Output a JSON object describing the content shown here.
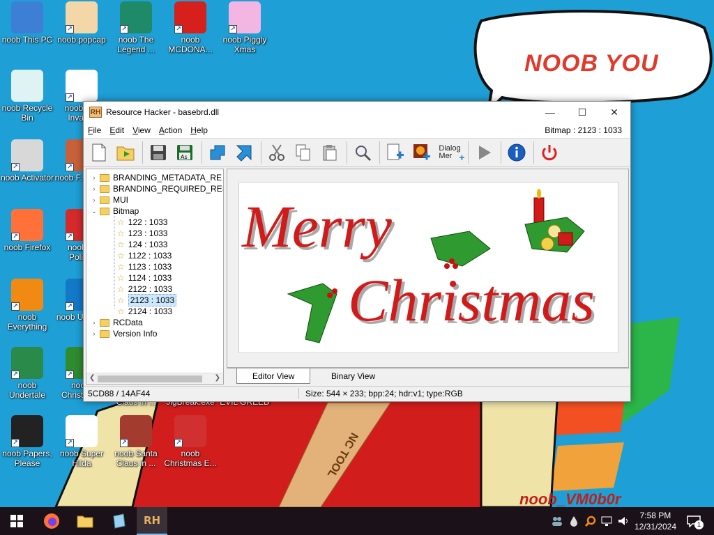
{
  "desktop": {
    "icons": [
      {
        "label": "noob This PC",
        "icon": "this-pc-icon",
        "color": "#3e7fd6"
      },
      {
        "label": "noob popcap",
        "icon": "popcap-icon",
        "color": "#f3d7a8"
      },
      {
        "label": "noob The Legend ...",
        "icon": "game-character-icon",
        "color": "#1f8a67"
      },
      {
        "label": "noob MCDONA...",
        "icon": "mcdonalds-icon",
        "color": "#d6201b"
      },
      {
        "label": "noob Piggly Xmas",
        "icon": "pig-icon",
        "color": "#f3b6e3"
      },
      {
        "label": "noob Recycle Bin",
        "icon": "recycle-bin-icon",
        "color": "#dff3f5"
      },
      {
        "label": "noob C... Invad...",
        "icon": "chicken-icon",
        "color": "#ffffff"
      },
      {
        "label": "noob Activator",
        "icon": "activator-icon",
        "color": "#d8d8d8"
      },
      {
        "label": "noob F... Pla...",
        "icon": "game-icon",
        "color": "#c8603a"
      },
      {
        "label": "noob Firefox",
        "icon": "firefox-icon",
        "color": "#ff7139"
      },
      {
        "label": "noob ... Politi...",
        "icon": "politics-icon",
        "color": "#d42a2a"
      },
      {
        "label": "noob Everything",
        "icon": "search-magnifier-icon",
        "color": "#f08a12"
      },
      {
        "label": "noob UltraV...",
        "icon": "ultraviewer-icon",
        "color": "#1478c8"
      },
      {
        "label": "noob Undertale",
        "icon": "undertale-icon",
        "color": "#2a8a4a"
      },
      {
        "label": "noo... Christma...",
        "icon": "christmas-tree-icon",
        "color": "#2e8b2e"
      },
      {
        "label": "noob Papers, Please",
        "icon": "papers-please-icon",
        "color": "#222222"
      },
      {
        "label": "noob Super Hilda",
        "icon": "super-hilda-icon",
        "color": "#ffffff"
      },
      {
        "label": "noob Santa Claus in ...",
        "icon": "santa-icon",
        "color": "#a43b2f"
      },
      {
        "label": "noob Christmas E...",
        "icon": "christmas-santa-icon",
        "color": "#d03030"
      }
    ],
    "partial_labels": [
      "Claus in ...",
      "JigBreak.exe",
      "EVIL GREED"
    ],
    "speech_bubble": "NOOB YOU",
    "watermark": "noob_VM0b0r"
  },
  "window": {
    "title": "Resource Hacker - basebrd.dll",
    "logo": "RH",
    "menu": [
      {
        "pre": "",
        "u": "F",
        "post": "ile"
      },
      {
        "pre": "",
        "u": "E",
        "post": "dit"
      },
      {
        "pre": "",
        "u": "V",
        "post": "iew"
      },
      {
        "pre": "",
        "u": "A",
        "post": "ction"
      },
      {
        "pre": "",
        "u": "H",
        "post": "elp"
      }
    ],
    "resource_id": "Bitmap : 2123 : 1033",
    "toolbar": {
      "dialog_label_1": "Dialog",
      "dialog_label_2": "Mer"
    },
    "tree": [
      {
        "label": "BRANDING_METADATA_RE",
        "type": "folder",
        "expander": "›"
      },
      {
        "label": "BRANDING_REQUIRED_RES",
        "type": "folder",
        "expander": "›"
      },
      {
        "label": "MUI",
        "type": "folder",
        "expander": "›"
      },
      {
        "label": "Bitmap",
        "type": "folder-open",
        "expander": "⌄"
      },
      {
        "label": "122 : 1033",
        "type": "item"
      },
      {
        "label": "123 : 1033",
        "type": "item"
      },
      {
        "label": "124 : 1033",
        "type": "item"
      },
      {
        "label": "1122 : 1033",
        "type": "item"
      },
      {
        "label": "1123 : 1033",
        "type": "item"
      },
      {
        "label": "1124 : 1033",
        "type": "item"
      },
      {
        "label": "2122 : 1033",
        "type": "item"
      },
      {
        "label": "2123 : 1033",
        "type": "item",
        "selected": true
      },
      {
        "label": "2124 : 1033",
        "type": "item"
      },
      {
        "label": "RCData",
        "type": "folder",
        "expander": "›"
      },
      {
        "label": "Version Info",
        "type": "folder",
        "expander": "›"
      }
    ],
    "bitmap_text": {
      "line1": "Merry",
      "line2": "Christmas"
    },
    "tabs": [
      {
        "label": "Editor View",
        "active": true
      },
      {
        "label": "Binary View",
        "active": false
      }
    ],
    "status": {
      "offset": "5CD88 / 14AF44",
      "info": "Size: 544 × 233;  bpp:24;  hdr:v1;  type:RGB"
    }
  },
  "taskbar": {
    "clock_time": "7:58 PM",
    "clock_date": "12/31/2024",
    "notification_count": "1",
    "active_app": "RH"
  },
  "colors": {
    "desktop_bg": "#1e9fd6",
    "christmas_red": "#d11a1a",
    "holly_green": "#2f9a2f"
  }
}
